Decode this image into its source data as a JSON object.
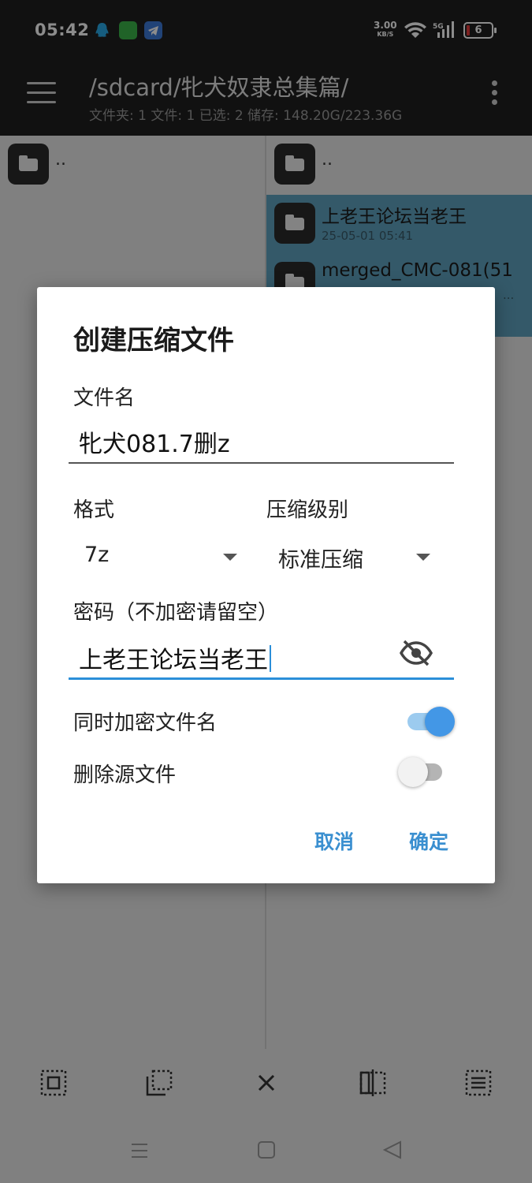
{
  "status_bar": {
    "time": "05:42",
    "net_speed": "3.00",
    "net_unit": "KB/S",
    "signal_label": "5G",
    "battery": "6"
  },
  "app_bar": {
    "path": "/sdcard/牝犬奴隶总集篇/",
    "stats": "文件夹: 1  文件: 1  已选: 2  储存: 148.20G/223.36G"
  },
  "left_pane": {
    "parent": ".."
  },
  "right_pane": {
    "parent": "..",
    "items": [
      {
        "name": "上老王论坛当老王",
        "date": "25-05-01 05:41"
      },
      {
        "name": "merged_CMC-081(51",
        "date": "..."
      }
    ]
  },
  "dialog": {
    "title": "创建压缩文件",
    "filename_label": "文件名",
    "filename_value": "牝犬081.7删z",
    "format_label": "格式",
    "format_value": "7z",
    "level_label": "压缩级别",
    "level_value": "标准压缩",
    "password_label": "密码（不加密请留空）",
    "password_value": "上老王论坛当老王",
    "encrypt_names_label": "同时加密文件名",
    "encrypt_names_on": true,
    "delete_source_label": "删除源文件",
    "delete_source_on": false,
    "cancel_label": "取消",
    "ok_label": "确定"
  },
  "colors": {
    "accent": "#3a8fd0",
    "selection": "#5fa3c0",
    "appbar": "#1f1f1f"
  }
}
